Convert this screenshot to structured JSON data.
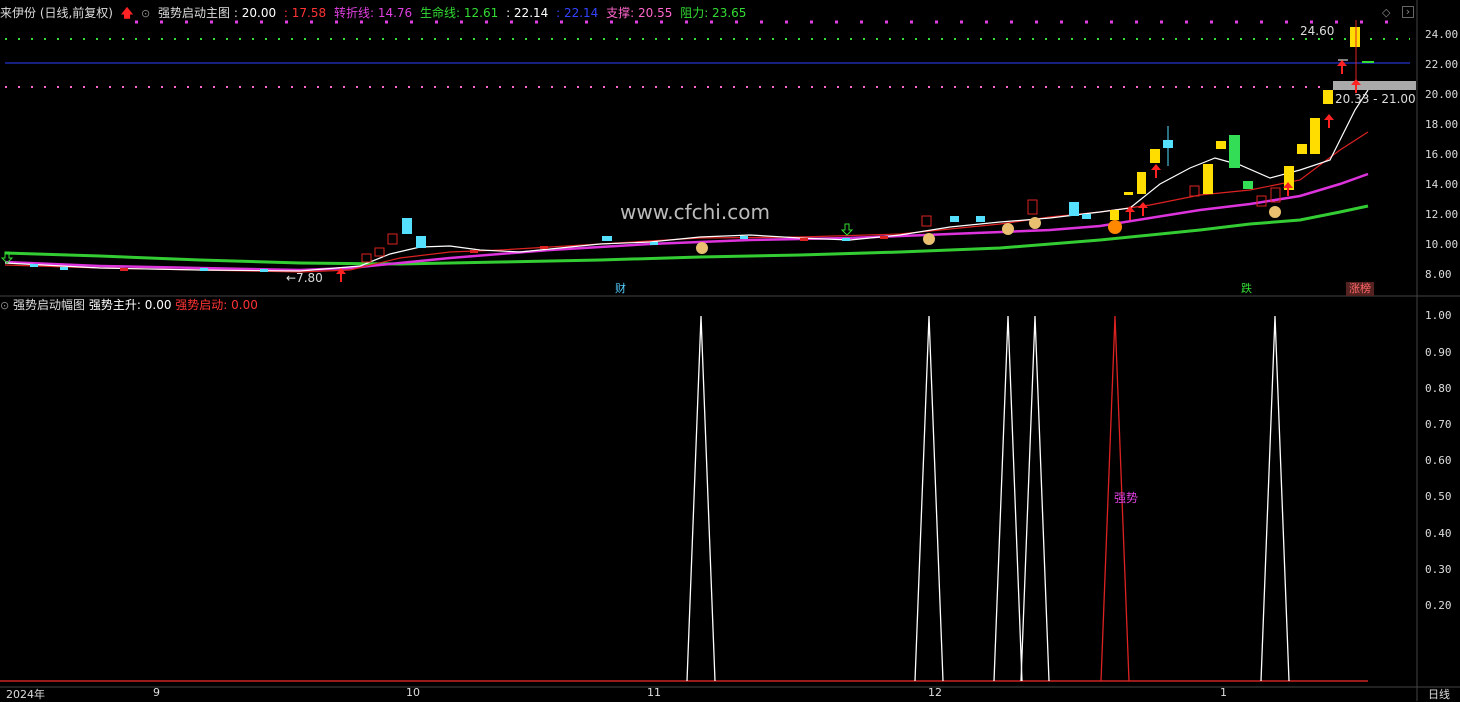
{
  "header": {
    "stock_name": "来伊份 (日线,前复权)",
    "indicator_name": "强势启动主图 : ",
    "indicator_value": "20.00",
    "v1": ": 17.58",
    "turn_label": "转折线: 14.76",
    "life_label": "生命线: 12.61",
    "v2": ": 22.14",
    "v3": ": 22.14",
    "support_label": "支撑: 20.55",
    "resist_label": "阻力: 23.65",
    "arrow_icon": "red-up-arrow",
    "colors": {
      "white": "#ffffff",
      "red": "#ff3333",
      "magenta": "#e040e0",
      "green": "#33dd33",
      "blue": "#3344ff",
      "yellow": "#ffff00"
    }
  },
  "sub_header": {
    "title": "强势启动幅图",
    "strong_up": "强势主升: 0.00",
    "strong_start": "强势启动: 0.00"
  },
  "annotations": {
    "high_price": "24.60",
    "low_price": "←7.80",
    "range_price": "20.33 - 21.00",
    "tag_cai": "财",
    "tag_die": "跌",
    "tag_zhangban": "涨榜",
    "watermark": "www.cfchi.com",
    "strong_label": "强势"
  },
  "y_axis_main": [
    "24.00",
    "22.00",
    "20.00",
    "18.00",
    "16.00",
    "14.00",
    "12.00",
    "10.00",
    "8.00"
  ],
  "y_axis_sub": [
    "1.00",
    "0.90",
    "0.80",
    "0.70",
    "0.60",
    "0.50",
    "0.40",
    "0.30",
    "0.20"
  ],
  "x_axis": [
    "2024年",
    "9",
    "10",
    "11",
    "12",
    "1"
  ],
  "period_label": "日线"
}
